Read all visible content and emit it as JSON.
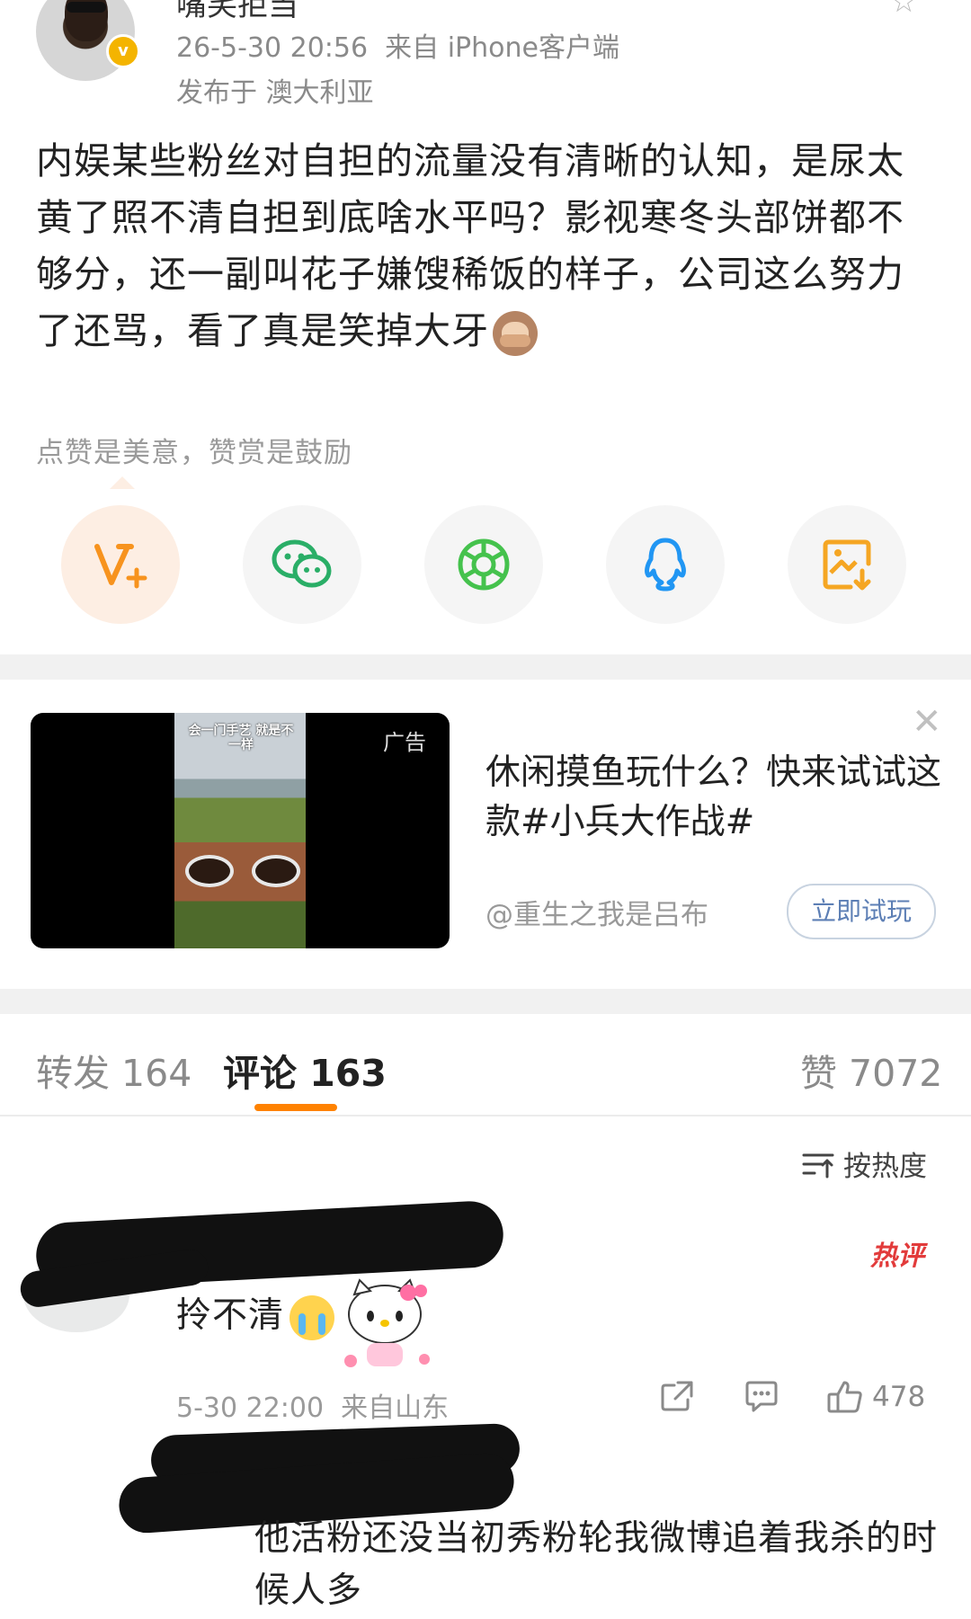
{
  "post": {
    "username": "嘴笑拒当",
    "time": "26-5-30 20:56",
    "source": "来自 iPhone客户端",
    "location": "发布于 澳大利亚",
    "text": "内娱某些粉丝对自担的流量没有清晰的认知，是尿太黄了照不清自担到底啥水平吗？影视寒冬头部饼都不够分，还一副叫花子嫌馊稀饭的样子，公司这么努力了还骂，看了真是笑掉大牙"
  },
  "reward_hint": "点赞是美意，赞赏是鼓励",
  "share_icons": [
    "v-plus-reward-icon",
    "wechat-icon",
    "moments-icon",
    "qq-icon",
    "save-image-icon"
  ],
  "colors": {
    "accent": "#ff8200",
    "wechat": "#2aae67",
    "moments": "#45c24d",
    "qq": "#2196f3",
    "save": "#f5a623",
    "reward": "#f7931e"
  },
  "ad": {
    "tag": "广告",
    "video_caption": "会一门手艺 就是不一样",
    "title": "休闲摸鱼玩什么？快来试试这款#小兵大作战#",
    "author": "@重生之我是吕布",
    "cta": "立即试玩"
  },
  "tabs": {
    "repost": "转发 164",
    "comments": "评论 163",
    "likes": "赞 7072"
  },
  "sort_label": "按热度",
  "comments": [
    {
      "hot_badge": "热评",
      "text": "拎不清",
      "time": "5-30 22:00",
      "location": "来自山东",
      "likes": "478"
    },
    {
      "text": "他活粉还没当初秀粉轮我微博追着我杀的时候人多"
    }
  ]
}
